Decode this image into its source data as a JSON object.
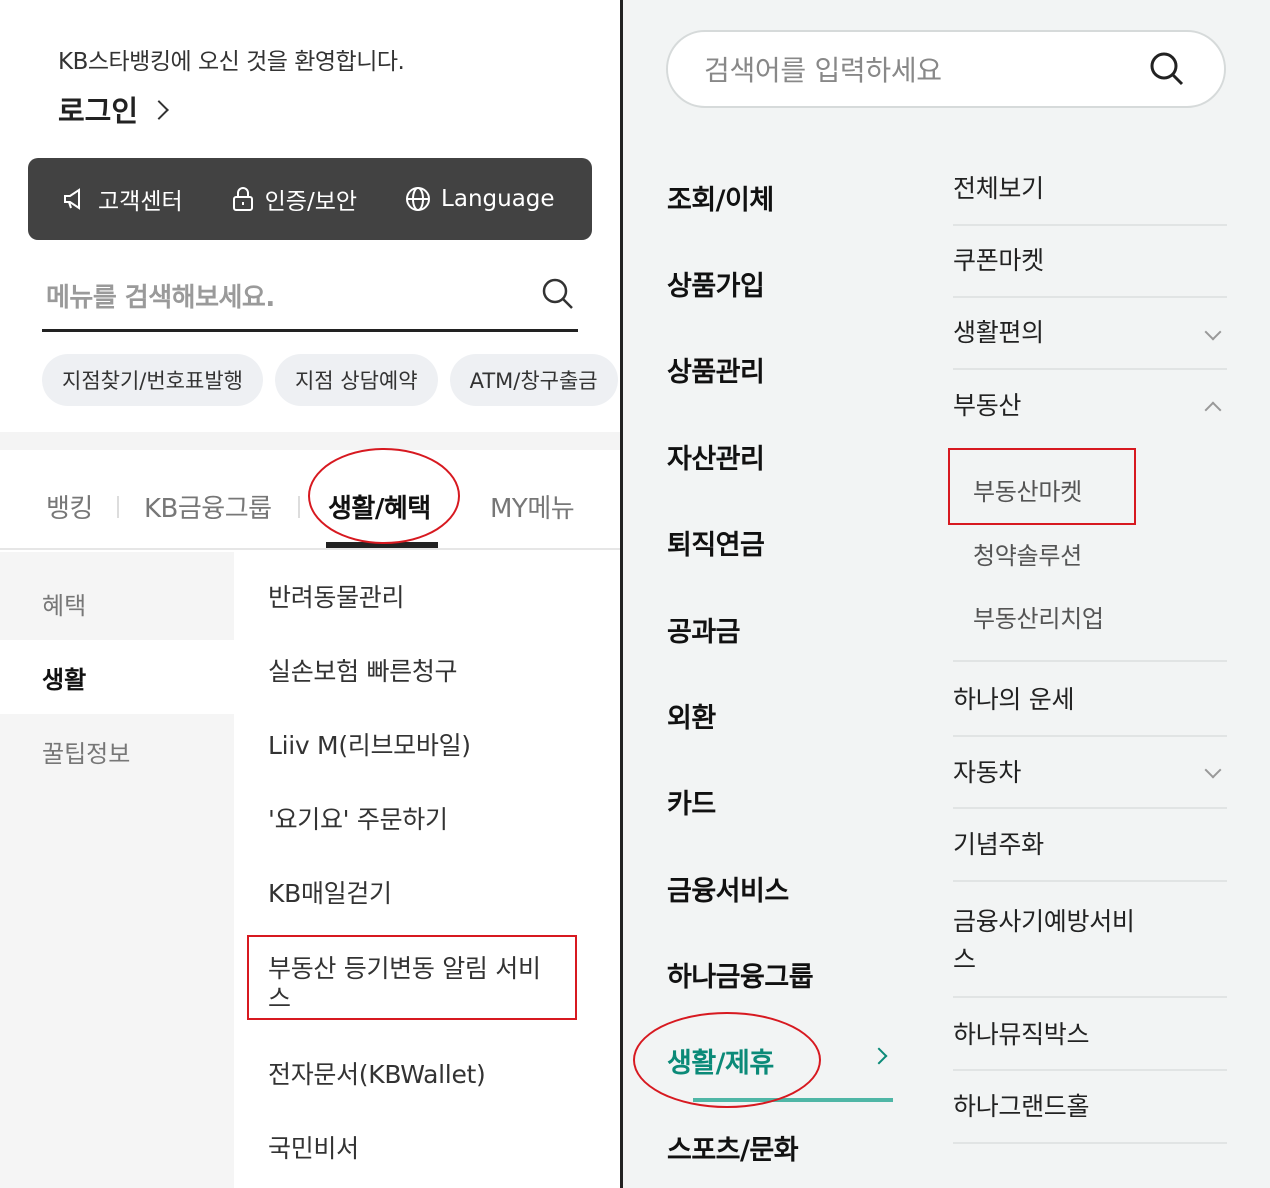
{
  "left": {
    "welcome": "KB스타뱅킹에 오신 것을 환영합니다.",
    "login": "로그인",
    "topbar": [
      {
        "icon": "megaphone-icon",
        "label": "고객센터"
      },
      {
        "icon": "lock-icon",
        "label": "인증/보안"
      },
      {
        "icon": "globe-icon",
        "label": "Language"
      }
    ],
    "search": {
      "placeholder": "메뉴를 검색해보세요."
    },
    "chips": [
      "지점찾기/번호표발행",
      "지점 상담예약",
      "ATM/창구출금"
    ],
    "tabs": [
      "뱅킹",
      "KB금융그룹",
      "생활/혜택",
      "MY메뉴"
    ],
    "active_tab": "생활/혜택",
    "sidemenu": [
      "혜택",
      "생활",
      "꿀팁정보"
    ],
    "active_side": "생활",
    "items": [
      "반려동물관리",
      "실손보험 빠른청구",
      "Liiv M(리브모바일)",
      "'요기요' 주문하기",
      "KB매일걷기",
      "부동산 등기변동 알림 서비스",
      "전자문서(KBWallet)",
      "국민비서"
    ]
  },
  "right": {
    "search": {
      "placeholder": "검색어를 입력하세요"
    },
    "categories": [
      "조회/이체",
      "상품가입",
      "상품관리",
      "자산관리",
      "퇴직연금",
      "공과금",
      "외환",
      "카드",
      "금융서비스",
      "하나금융그룹",
      "생활/제휴",
      "스포츠/문화"
    ],
    "active_category": "생활/제휴",
    "items": [
      {
        "label": "전체보기"
      },
      {
        "label": "쿠폰마켓"
      },
      {
        "label": "생활편의",
        "expand": "down"
      },
      {
        "label": "부동산",
        "expand": "up"
      },
      {
        "label": "하나의 운세"
      },
      {
        "label": "자동차",
        "expand": "down"
      },
      {
        "label": "기념주화"
      },
      {
        "label": "금융사기예방서비스"
      },
      {
        "label": "하나뮤직박스"
      },
      {
        "label": "하나그랜드홀"
      }
    ],
    "subitems": [
      "부동산마켓",
      "청약솔루션",
      "부동산리치업"
    ]
  },
  "colors": {
    "annotation": "#d71920",
    "accent": "#0b8a78",
    "dark_bar": "#424242"
  }
}
